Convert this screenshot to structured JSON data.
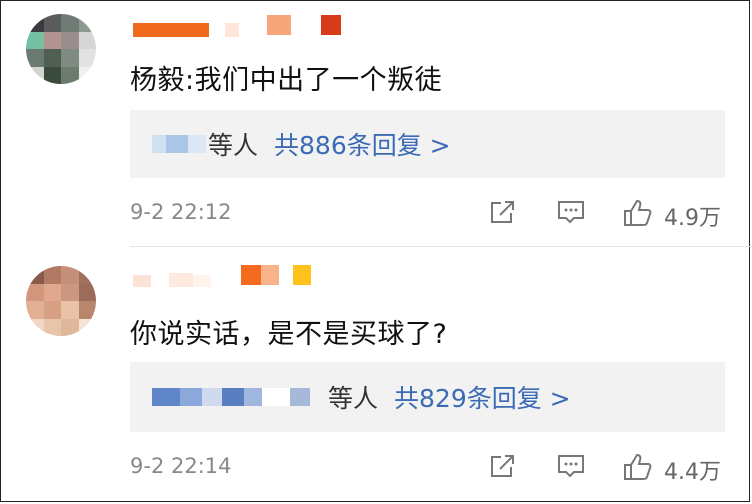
{
  "colors": {
    "link": "#3b6bb5",
    "text": "#111111",
    "meta": "#888888",
    "reply_bg": "#f2f2f2"
  },
  "comments": [
    {
      "text": "杨毅:我们中出了一个叛徒",
      "reply_who": "等人",
      "reply_count": "共886条回复 >",
      "time": "9-2 22:12",
      "likes": "4.9万",
      "icons": [
        "share-icon",
        "comment-icon",
        "like-icon"
      ]
    },
    {
      "text": "你说实话，是不是买球了?",
      "reply_who": "等人",
      "reply_count": "共829条回复 >",
      "time": "9-2 22:14",
      "likes": "4.4万",
      "icons": [
        "share-icon",
        "comment-icon",
        "like-icon"
      ]
    }
  ]
}
